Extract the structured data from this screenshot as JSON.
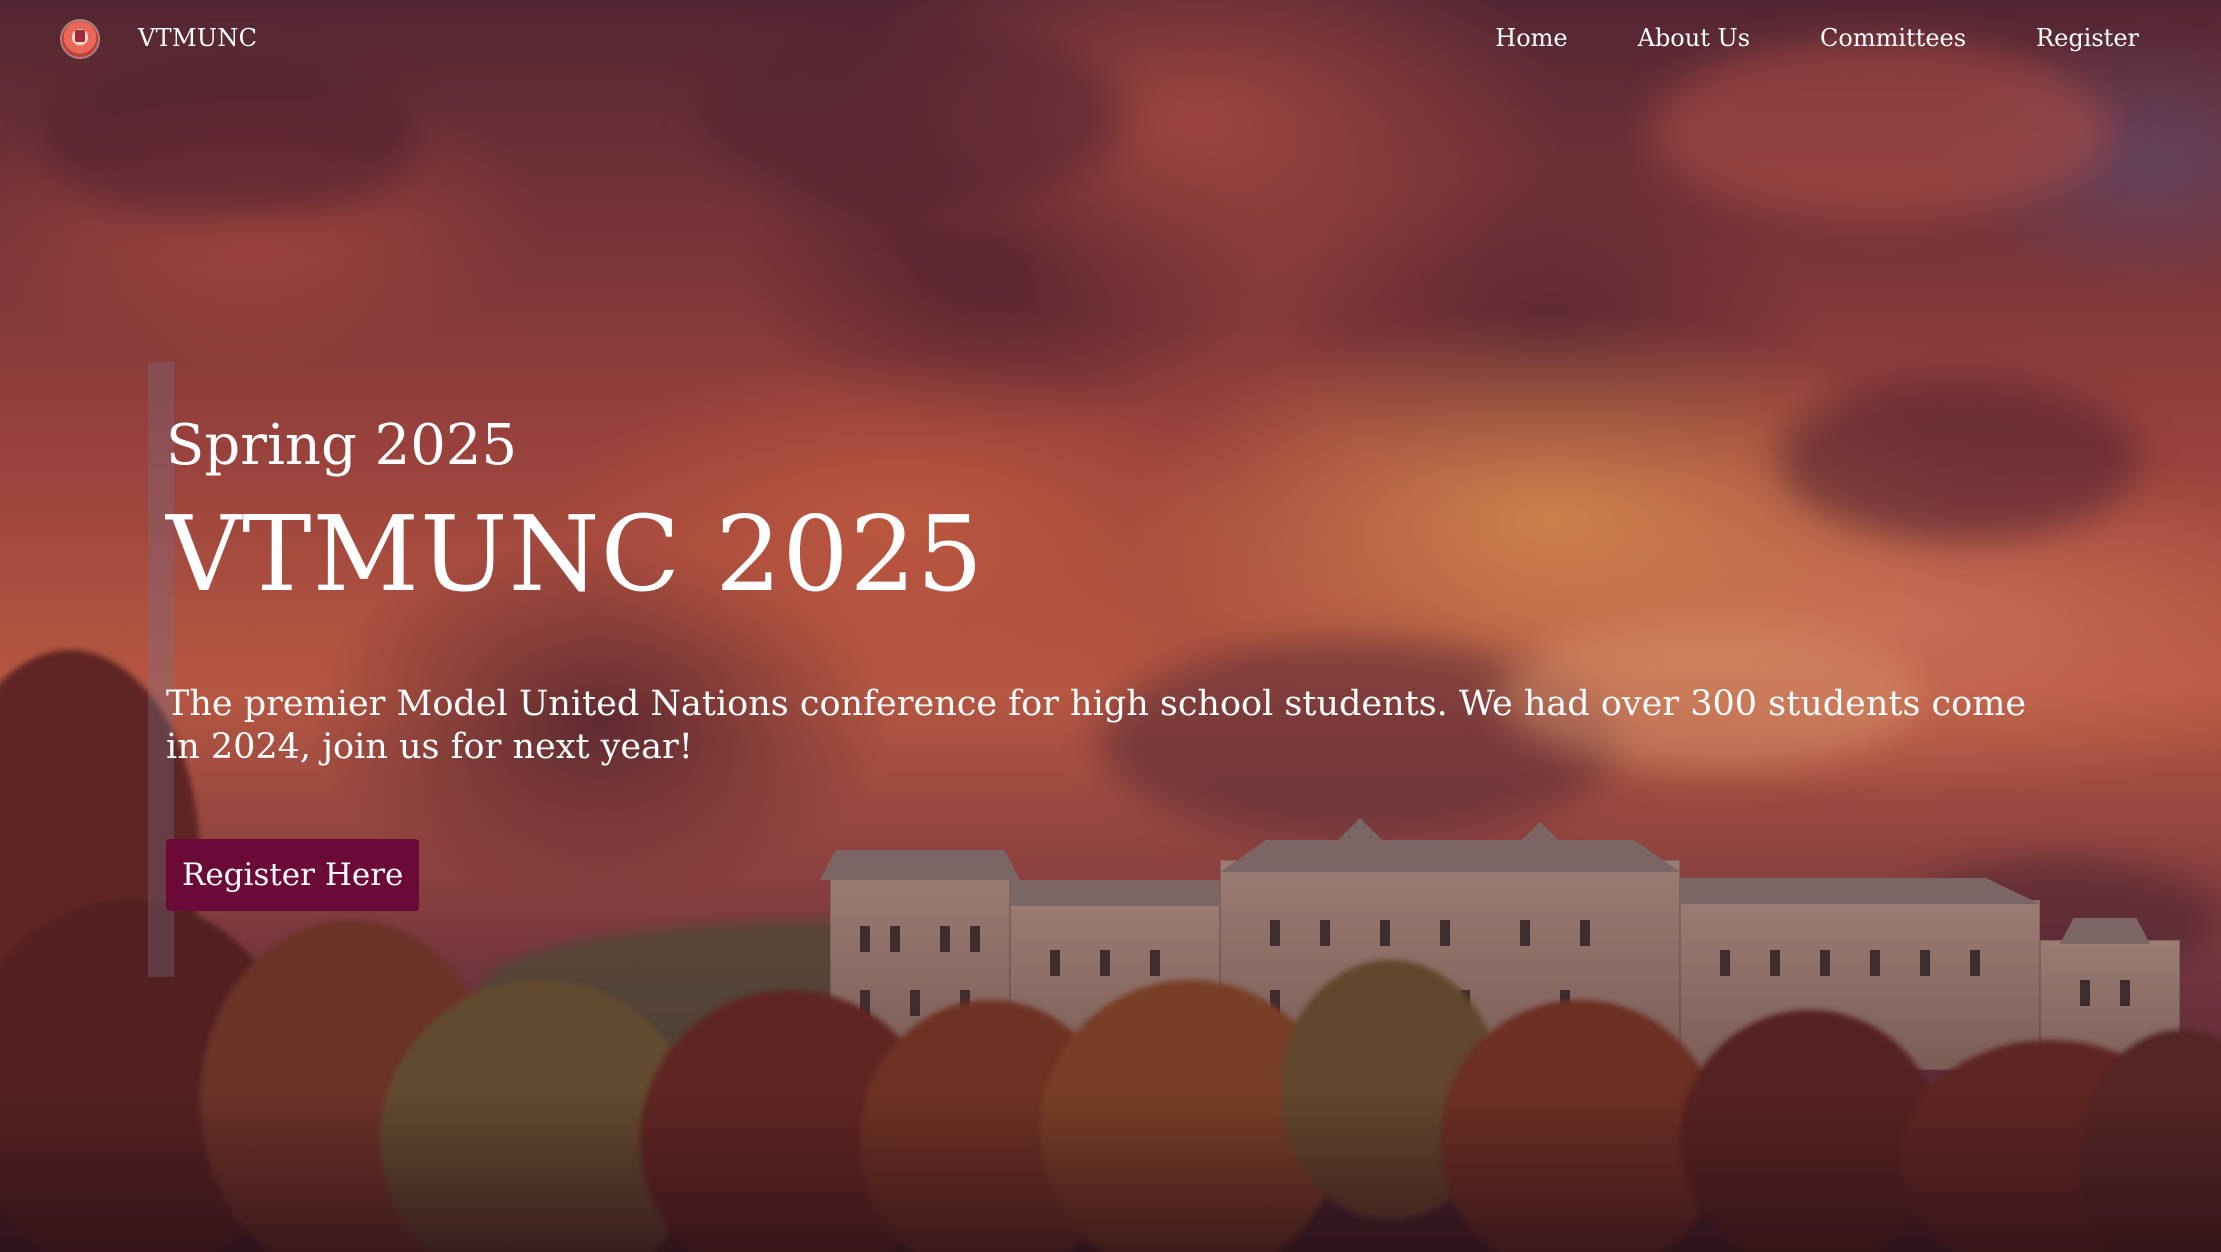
{
  "nav": {
    "brand": "VTMUNC",
    "links": [
      "Home",
      "About Us",
      "Committees",
      "Register"
    ]
  },
  "hero": {
    "subtitle": "Spring 2025",
    "title": "VTMUNC 2025",
    "description": "The premier Model United Nations conference for high school students. We had over 300 students come in 2024, join us for next year!",
    "cta_label": "Register Here"
  },
  "colors": {
    "cta_background": "#6b0a38",
    "text": "#ffffff"
  },
  "icons": {
    "logo": "vtmunc-logo-icon"
  }
}
